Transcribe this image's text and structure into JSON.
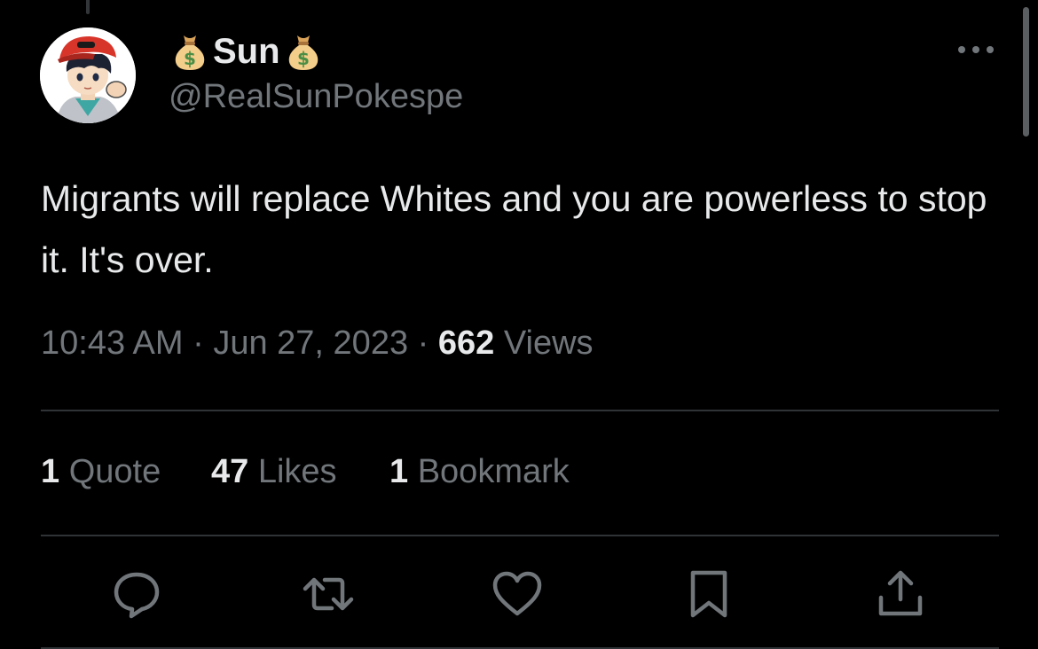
{
  "tweet": {
    "display_name": "Sun",
    "name_emoji": "money-bag-icon",
    "handle": "@RealSunPokespe",
    "text": "Migrants will replace Whites and you are powerless to stop it. It's over.",
    "time": "10:43 AM",
    "separator": "·",
    "date": "Jun 27, 2023",
    "views_count": "662",
    "views_label": "Views"
  },
  "stats": {
    "quotes_count": "1",
    "quotes_label": "Quote",
    "likes_count": "47",
    "likes_label": "Likes",
    "bookmarks_count": "1",
    "bookmarks_label": "Bookmark"
  },
  "actions": [
    "reply-icon",
    "retweet-icon",
    "like-icon",
    "bookmark-icon",
    "share-icon"
  ],
  "colors": {
    "background": "#000000",
    "primary_text": "#e7e9ea",
    "secondary_text": "#71767b",
    "divider": "#2f3336",
    "avatar_cap": "#d8352a"
  }
}
